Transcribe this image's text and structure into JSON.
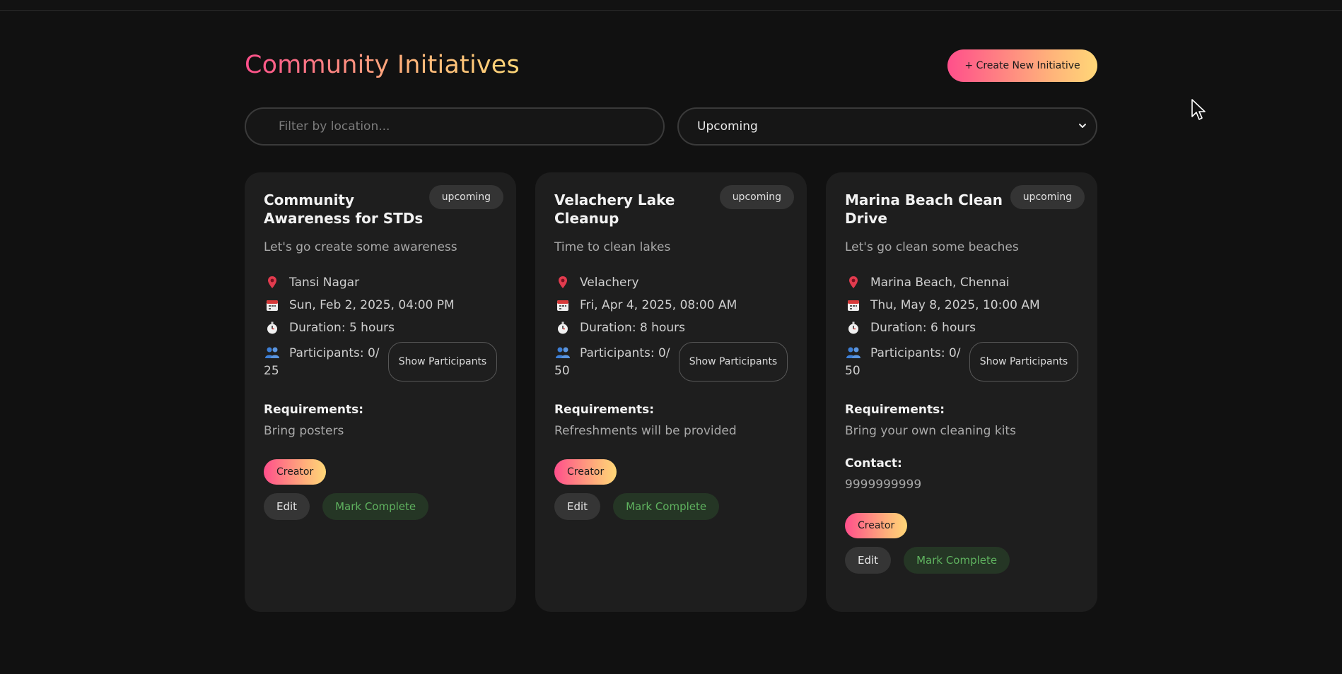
{
  "header": {
    "title": "Community Initiatives",
    "create_button": "+ Create New Initiative"
  },
  "filters": {
    "location_placeholder": "Filter by location...",
    "status_selected": "Upcoming"
  },
  "labels": {
    "requirements": "Requirements:",
    "contact": "Contact:",
    "show_participants": "Show Participants",
    "creator": "Creator",
    "edit": "Edit",
    "mark_complete": "Mark Complete"
  },
  "initiatives": [
    {
      "title": "Community Awareness for STDs",
      "status": "upcoming",
      "description": "Let's go create some awareness",
      "location": "Tansi Nagar",
      "datetime": "Sun, Feb 2, 2025, 04:00 PM",
      "duration": "Duration: 5 hours",
      "participants": "Participants: 0/ 25",
      "requirements": "Bring posters"
    },
    {
      "title": "Velachery Lake Cleanup",
      "status": "upcoming",
      "description": "Time to clean lakes",
      "location": "Velachery",
      "datetime": "Fri, Apr 4, 2025, 08:00 AM",
      "duration": "Duration: 8 hours",
      "participants": "Participants: 0/ 50",
      "requirements": "Refreshments will be provided"
    },
    {
      "title": "Marina Beach Clean Drive",
      "status": "upcoming",
      "description": "Let's go clean some beaches",
      "location": "Marina Beach, Chennai",
      "datetime": "Thu, May 8, 2025, 10:00 AM",
      "duration": "Duration: 6 hours",
      "participants": "Participants: 0/ 50",
      "requirements": "Bring your own cleaning kits",
      "contact": "9999999999"
    }
  ],
  "icons": {
    "location": "pin-icon",
    "date": "calendar-icon",
    "duration": "stopwatch-icon",
    "participants": "people-icon"
  },
  "colors": {
    "background": "#111111",
    "card": "#1e1e1e",
    "gradient_start": "#ff4f8b",
    "gradient_end": "#ffd777",
    "complete_text": "#5fb25f"
  }
}
